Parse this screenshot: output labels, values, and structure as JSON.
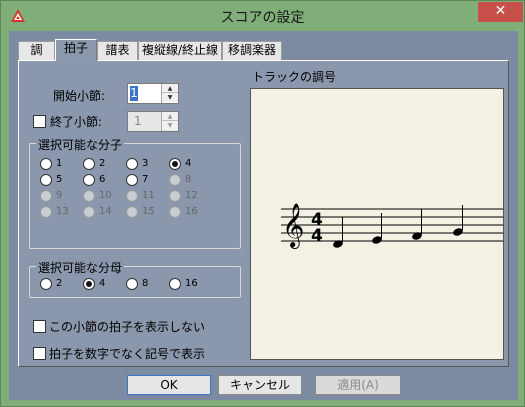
{
  "window": {
    "title": "スコアの設定",
    "close_label": "✕",
    "accent": "#7fae78"
  },
  "tabs": [
    {
      "label": "調"
    },
    {
      "label": "拍子"
    },
    {
      "label": "譜表"
    },
    {
      "label": "複縦線/終止線"
    },
    {
      "label": "移調楽器"
    }
  ],
  "start_measure": {
    "label": "開始小節:",
    "value": "1"
  },
  "end_measure": {
    "label": "終了小節:",
    "value": "1"
  },
  "numerator_group": {
    "title": "選択可能な分子",
    "options": [
      {
        "label": "1",
        "checked": false,
        "enabled": true
      },
      {
        "label": "2",
        "checked": false,
        "enabled": true
      },
      {
        "label": "3",
        "checked": false,
        "enabled": true
      },
      {
        "label": "4",
        "checked": true,
        "enabled": true
      },
      {
        "label": "5",
        "checked": false,
        "enabled": true
      },
      {
        "label": "6",
        "checked": false,
        "enabled": true
      },
      {
        "label": "7",
        "checked": false,
        "enabled": true
      },
      {
        "label": "8",
        "checked": false,
        "enabled": false
      },
      {
        "label": "9",
        "checked": false,
        "enabled": false
      },
      {
        "label": "10",
        "checked": false,
        "enabled": false
      },
      {
        "label": "11",
        "checked": false,
        "enabled": false
      },
      {
        "label": "12",
        "checked": false,
        "enabled": false
      },
      {
        "label": "13",
        "checked": false,
        "enabled": false
      },
      {
        "label": "14",
        "checked": false,
        "enabled": false
      },
      {
        "label": "15",
        "checked": false,
        "enabled": false
      },
      {
        "label": "16",
        "checked": false,
        "enabled": false
      }
    ]
  },
  "denominator_group": {
    "title": "選択可能な分母",
    "options": [
      {
        "label": "2",
        "checked": false
      },
      {
        "label": "4",
        "checked": true
      },
      {
        "label": "8",
        "checked": false
      },
      {
        "label": "16",
        "checked": false
      }
    ]
  },
  "options": {
    "hide_time_signature": "この小節の拍子を表示しない",
    "symbol_display": "拍子を数字でなく記号で表示"
  },
  "track_preview": {
    "title": "トラックの調号",
    "time_sig_top": "4",
    "time_sig_bottom": "4"
  },
  "buttons": {
    "ok": "OK",
    "cancel": "キャンセル",
    "apply": "適用(A)"
  }
}
